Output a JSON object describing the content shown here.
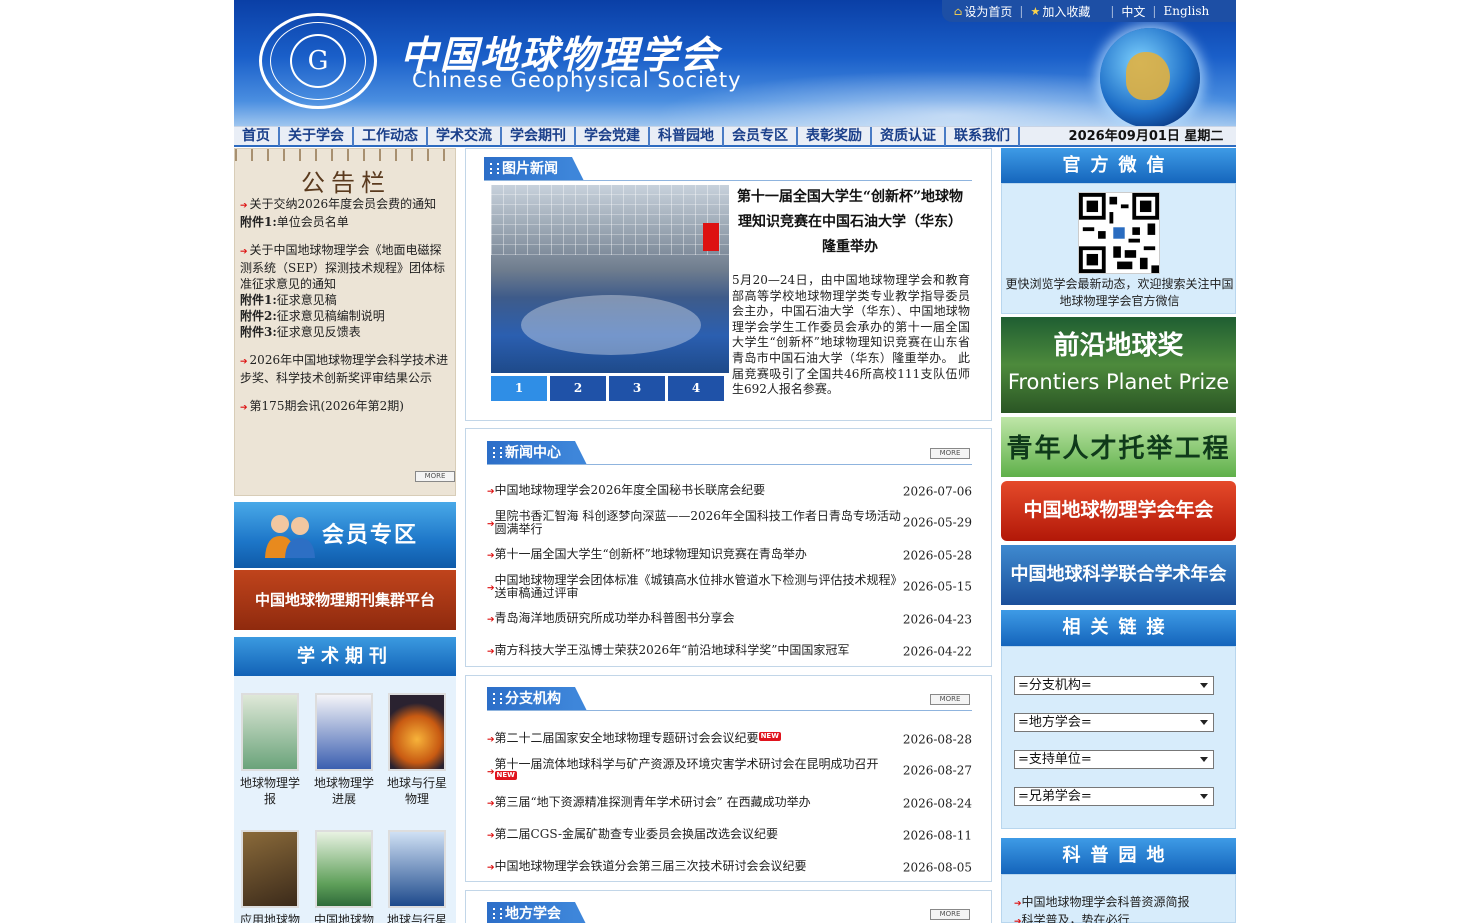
{
  "header": {
    "site_cn": "中国地球物理学会",
    "site_en": "Chinese Geophysical Society",
    "top_links": [
      "设为首页",
      "加入收藏",
      "中文",
      "English"
    ]
  },
  "nav": {
    "items": [
      "首页",
      "关于学会",
      "工作动态",
      "学术交流",
      "学会期刊",
      "学会党建",
      "科普园地",
      "会员专区",
      "表彰奖励",
      "资质认证",
      "联系我们"
    ],
    "date": "2026年09月01日 星期二"
  },
  "notice": {
    "title": "公告栏",
    "items": [
      {
        "text": "关于交纳2026年度会员会费的通知",
        "attach": [
          {
            "label": "附件1:",
            "text": "单位会员名单"
          }
        ]
      },
      {
        "text": "关于中国地球物理学会《地面电磁探测系统（SEP）探测技术规程》团体标准征求意见的通知",
        "attach": [
          {
            "label": "附件1:",
            "text": "征求意见稿"
          },
          {
            "label": "附件2:",
            "text": "征求意见稿编制说明"
          },
          {
            "label": "附件3:",
            "text": "征求意见反馈表"
          }
        ]
      },
      {
        "text": "2026年中国地球物理学会科学技术进步奖、科学技术创新奖评审结果公示",
        "attach": []
      },
      {
        "text": "第175期会讯(2026年第2期)",
        "attach": []
      }
    ],
    "more": "MORE"
  },
  "left_banners": {
    "member": "会员专区",
    "journal_platform": "中国地球物理期刊集群平台",
    "journals_title": "学术期刊"
  },
  "journals": [
    "地球物理学报",
    "地球物理学进展",
    "地球与行星物理",
    "应用地球物",
    "中国地球物",
    "地球与行星"
  ],
  "pic_news": {
    "title": "图片新闻",
    "headline": "第十一届全国大学生“创新杯”地球物理知识竞赛在中国石油大学（华东）隆重举办",
    "body": "5月20—24日，由中国地球物理学会和教育部高等学校地球物理学类专业教学指导委员会主办，中国石油大学（华东）、中国地球物理学会学生工作委员会承办的第十一届全国大学生“创新杯”地球物理知识竞赛在山东省青岛市中国石油大学（华东）隆重举办。 此届竞赛吸引了全国共46所高校111支队伍师生692人报名参赛。",
    "pages": [
      "1",
      "2",
      "3",
      "4"
    ]
  },
  "news_center": {
    "title": "新闻中心",
    "more": "MORE",
    "items": [
      {
        "t": "中国地球物理学会2026年度全国秘书长联席会纪要",
        "d": "2026-07-06"
      },
      {
        "t": "里院书香汇智海 科创逐梦向深蓝——2026年全国科技工作者日青岛专场活动圆满举行",
        "d": "2026-05-29"
      },
      {
        "t": "第十一届全国大学生“创新杯”地球物理知识竞赛在青岛举办",
        "d": "2026-05-28"
      },
      {
        "t": "中国地球物理学会团体标准《城镇高水位排水管道水下检测与评估技术规程》送审稿通过评审",
        "d": "2026-05-15"
      },
      {
        "t": "青岛海洋地质研究所成功举办科普图书分享会",
        "d": "2026-04-23"
      },
      {
        "t": "南方科技大学王泓博士荣获2026年“前沿地球科学奖”中国国家冠军",
        "d": "2026-04-22"
      }
    ]
  },
  "branches": {
    "title": "分支机构",
    "more": "MORE",
    "new_badge": "NEW",
    "items": [
      {
        "t": "第二十二届国家安全地球物理专题研讨会会议纪要",
        "d": "2026-08-28",
        "new": true
      },
      {
        "t": "第十一届流体地球科学与矿产资源及环境灾害学术研讨会在昆明成功召开",
        "d": "2026-08-27",
        "new": true
      },
      {
        "t": "第三届“地下资源精准探测青年学术研讨会” 在西藏成功举办",
        "d": "2026-08-24",
        "new": false
      },
      {
        "t": "第二届CGS-金属矿勘查专业委员会换届改选会议纪要",
        "d": "2026-08-11",
        "new": false
      },
      {
        "t": "中国地球物理学会铁道分会第三届三次技术研讨会会议纪要",
        "d": "2026-08-05",
        "new": false
      }
    ]
  },
  "local": {
    "title": "地方学会",
    "more": "MORE"
  },
  "right": {
    "wechat_title": "官方微信",
    "wechat_text": "更快浏览学会最新动态，欢迎搜索关注中国地球物理学会官方微信",
    "prize_cn": "前沿地球奖",
    "prize_en": "Frontiers Planet Prize",
    "youth": "青年人才托举工程",
    "annual": "中国地球物理学会年会",
    "geo_union": "中国地球科学联合学术年会",
    "links_title": "相关链接",
    "selects": [
      "=分支机构=",
      "=地方学会=",
      "=支持单位=",
      "=兄弟学会="
    ],
    "kp_title": "科普园地",
    "kp_items": [
      "中国地球物理学会科普资源简报",
      "科学普及，势在必行"
    ]
  }
}
